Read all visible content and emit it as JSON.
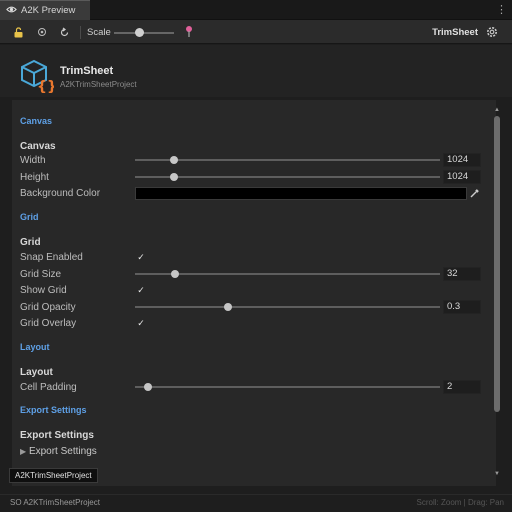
{
  "tab": {
    "label": "A2K Preview"
  },
  "toolbar": {
    "scale_label": "Scale",
    "scale_value": 0.45,
    "document_title": "TrimSheet",
    "icons": [
      "unlock-icon",
      "record-icon",
      "reset-icon",
      "pin-icon",
      "gear-icon"
    ]
  },
  "header": {
    "title": "TrimSheet",
    "subtitle": "A2KTrimSheetProject"
  },
  "sections": {
    "canvas": {
      "head": "Canvas",
      "group": "Canvas",
      "width_label": "Width",
      "width_value": "1024",
      "height_label": "Height",
      "height_value": "1024",
      "bg_label": "Background Color",
      "bg_color": "#000000"
    },
    "grid": {
      "head": "Grid",
      "group": "Grid",
      "snap_label": "Snap Enabled",
      "snap_checked": true,
      "size_label": "Grid Size",
      "size_value": "32",
      "show_label": "Show Grid",
      "show_checked": true,
      "opacity_label": "Grid Opacity",
      "opacity_value": "0.3",
      "overlay_label": "Grid Overlay",
      "overlay_checked": true
    },
    "layout": {
      "head": "Layout",
      "group": "Layout",
      "padding_label": "Cell Padding",
      "padding_value": "2"
    },
    "export": {
      "head": "Export Settings",
      "group": "Export Settings",
      "foldout_label": "Export Settings"
    }
  },
  "tooltip": {
    "text": "A2KTrimSheetProject"
  },
  "status": {
    "left": "SO   A2KTrimSheetProject",
    "right": "Scroll: Zoom  |  Drag: Pan"
  },
  "colors": {
    "accent": "#5ea0e6",
    "logo": "#4aa8d8",
    "logo_brace": "#e8772e",
    "pin": "#e0609a"
  }
}
